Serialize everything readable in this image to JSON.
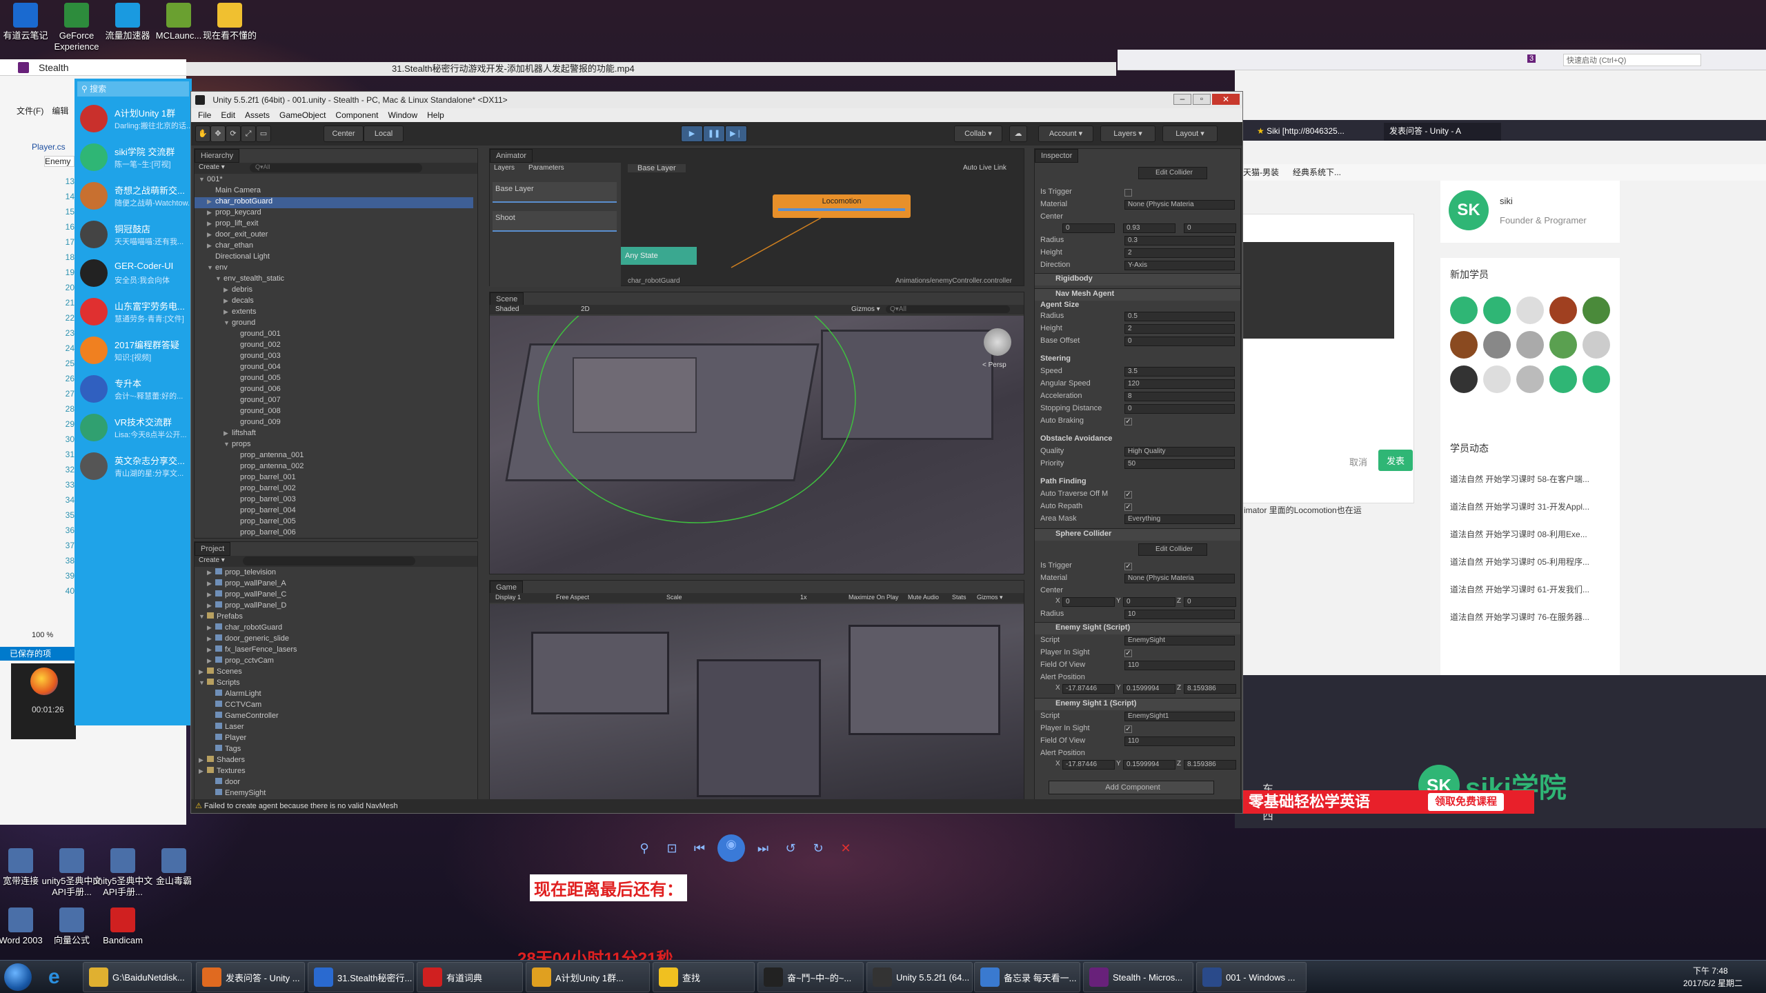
{
  "desktop": {
    "icons_top": [
      "有道云笔记",
      "GeForce Experience",
      "流量加速器",
      "MCLaunc...",
      "现在看不懂的"
    ],
    "icons_bottom": [
      "宽带连接",
      "unity5圣典中文API手册...",
      "unity5圣典中文API手册...",
      "金山毒霸",
      "Word 2003",
      "向量公式",
      "Bandicam"
    ],
    "countdown_label": "现在距离最后还有：",
    "countdown_value": "28天04小时11分21秒"
  },
  "video_player": {
    "title": "31.Stealth秘密行动游戏开发-添加机器人发起警报的功能.mp4",
    "time": "00:01:26"
  },
  "vs": {
    "title": "Stealth",
    "menu": [
      "文件(F)",
      "编辑"
    ],
    "tab": "Player.cs",
    "dropdown": "Enemy",
    "line_numbers": [
      "13",
      "14",
      "15",
      "16",
      "17",
      "18",
      "19",
      "20",
      "21",
      "22",
      "23",
      "24",
      "25",
      "26",
      "27",
      "28",
      "29",
      "30",
      "31",
      "32",
      "33",
      "34",
      "35",
      "36",
      "37",
      "38",
      "39",
      "40"
    ],
    "zoom": "100 %",
    "status": "已保存的项",
    "quick_launch": "快速启动 (Ctrl+Q)",
    "badge": "3"
  },
  "qq": {
    "search": "搜索",
    "items": [
      {
        "name": "A计划Unity 1群",
        "msg": "Darling:搬往北京的话...",
        "color": "#c9302c"
      },
      {
        "name": "siki学院 交流群",
        "msg": "陈一笔~生:[可视]",
        "color": "#2fb675"
      },
      {
        "name": "奇想之战萌新交...",
        "msg": "随便之战萌-Watchtow...",
        "color": "#c87030"
      },
      {
        "name": "铜冠鼓店",
        "msg": "天天喵喵喵:还有我...",
        "color": "#444"
      },
      {
        "name": "GER-Coder-UI",
        "msg": "安全员:我会向体",
        "color": "#222"
      },
      {
        "name": "山东富宇劳务电...",
        "msg": "慧通劳务-青青:[文件]",
        "color": "#e03030"
      },
      {
        "name": "2017编程群答疑",
        "msg": "知识:[视频]",
        "color": "#f08020"
      },
      {
        "name": "专升本",
        "msg": "会计~-释慧蕾:好的...",
        "color": "#3060c0"
      },
      {
        "name": "VR技术交流群",
        "msg": "Lisa:今天8点半公开...",
        "color": "#30a070"
      },
      {
        "name": "英文杂志分享交...",
        "msg": "青山湖的星:分享文...",
        "color": "#555"
      }
    ]
  },
  "browser": {
    "tabs": [
      "Siki [http://8046325...",
      "发表问答 - Unity - A"
    ],
    "bookmarks": [
      "天猫-男装",
      "经典系统下..."
    ],
    "profile": {
      "name": "siki",
      "role": "Founder & Programer"
    },
    "new_students_title": "新加学员",
    "activity_title": "学员动态",
    "activities": [
      "道法自然 开始学习课时 58-在客户端...",
      "道法自然 开始学习课时 31-开发Appl...",
      "道法自然 开始学习课时 08-利用Exe...",
      "道法自然 开始学习课时 05-利用程序...",
      "道法自然 开始学习课时 61-开发我们...",
      "道法自然 开始学习课时 76-在服务器..."
    ],
    "cancel": "取消",
    "submit": "发表",
    "text_snippet": "imator 里面的Locomotion也在运",
    "logo": "siki学院",
    "side_chars": [
      "东",
      "西"
    ],
    "banner": "零基础轻松学英语",
    "banner_btn": "领取免费课程"
  },
  "unity": {
    "title": "Unity 5.5.2f1 (64bit) - 001.unity - Stealth - PC, Mac & Linux Standalone* <DX11>",
    "menu": [
      "File",
      "Edit",
      "Assets",
      "GameObject",
      "Component",
      "Window",
      "Help"
    ],
    "toolbar": {
      "center": "Center",
      "local": "Local",
      "collab": "Collab ▾",
      "account": "Account ▾",
      "layers": "Layers ▾",
      "layout": "Layout ▾"
    },
    "hierarchy": {
      "tab": "Hierarchy",
      "create": "Create ▾",
      "search": "Q▾All",
      "rows": [
        {
          "t": "001*",
          "d": 0,
          "a": "▼"
        },
        {
          "t": "Main Camera",
          "d": 1,
          "a": ""
        },
        {
          "t": "char_robotGuard",
          "d": 1,
          "a": "▶",
          "sel": true
        },
        {
          "t": "prop_keycard",
          "d": 1,
          "a": "▶"
        },
        {
          "t": "prop_lift_exit",
          "d": 1,
          "a": "▶"
        },
        {
          "t": "door_exit_outer",
          "d": 1,
          "a": "▶"
        },
        {
          "t": "char_ethan",
          "d": 1,
          "a": "▶"
        },
        {
          "t": "Directional Light",
          "d": 1,
          "a": ""
        },
        {
          "t": "env",
          "d": 1,
          "a": "▼"
        },
        {
          "t": "env_stealth_static",
          "d": 2,
          "a": "▼"
        },
        {
          "t": "debris",
          "d": 3,
          "a": "▶"
        },
        {
          "t": "decals",
          "d": 3,
          "a": "▶"
        },
        {
          "t": "extents",
          "d": 3,
          "a": "▶"
        },
        {
          "t": "ground",
          "d": 3,
          "a": "▼"
        },
        {
          "t": "ground_001",
          "d": 4,
          "a": ""
        },
        {
          "t": "ground_002",
          "d": 4,
          "a": ""
        },
        {
          "t": "ground_003",
          "d": 4,
          "a": ""
        },
        {
          "t": "ground_004",
          "d": 4,
          "a": ""
        },
        {
          "t": "ground_005",
          "d": 4,
          "a": ""
        },
        {
          "t": "ground_006",
          "d": 4,
          "a": ""
        },
        {
          "t": "ground_007",
          "d": 4,
          "a": ""
        },
        {
          "t": "ground_008",
          "d": 4,
          "a": ""
        },
        {
          "t": "ground_009",
          "d": 4,
          "a": ""
        },
        {
          "t": "liftshaft",
          "d": 3,
          "a": "▶"
        },
        {
          "t": "props",
          "d": 3,
          "a": "▼"
        },
        {
          "t": "prop_antenna_001",
          "d": 4,
          "a": ""
        },
        {
          "t": "prop_antenna_002",
          "d": 4,
          "a": ""
        },
        {
          "t": "prop_barrel_001",
          "d": 4,
          "a": ""
        },
        {
          "t": "prop_barrel_002",
          "d": 4,
          "a": ""
        },
        {
          "t": "prop_barrel_003",
          "d": 4,
          "a": ""
        },
        {
          "t": "prop_barrel_004",
          "d": 4,
          "a": ""
        },
        {
          "t": "prop_barrel_005",
          "d": 4,
          "a": ""
        },
        {
          "t": "prop_barrel_006",
          "d": 4,
          "a": ""
        }
      ]
    },
    "project": {
      "tab": "Project",
      "create": "Create ▾",
      "rows": [
        {
          "t": "prop_television",
          "d": 1,
          "a": "▶"
        },
        {
          "t": "prop_wallPanel_A",
          "d": 1,
          "a": "▶"
        },
        {
          "t": "prop_wallPanel_C",
          "d": 1,
          "a": "▶"
        },
        {
          "t": "prop_wallPanel_D",
          "d": 1,
          "a": "▶"
        },
        {
          "t": "Prefabs",
          "d": 0,
          "a": "▼"
        },
        {
          "t": "char_robotGuard",
          "d": 1,
          "a": "▶"
        },
        {
          "t": "door_generic_slide",
          "d": 1,
          "a": "▶"
        },
        {
          "t": "fx_laserFence_lasers",
          "d": 1,
          "a": "▶"
        },
        {
          "t": "prop_cctvCam",
          "d": 1,
          "a": "▶"
        },
        {
          "t": "Scenes",
          "d": 0,
          "a": "▶"
        },
        {
          "t": "Scripts",
          "d": 0,
          "a": "▼"
        },
        {
          "t": "AlarmLight",
          "d": 1,
          "a": ""
        },
        {
          "t": "CCTVCam",
          "d": 1,
          "a": ""
        },
        {
          "t": "GameController",
          "d": 1,
          "a": ""
        },
        {
          "t": "Laser",
          "d": 1,
          "a": ""
        },
        {
          "t": "Player",
          "d": 1,
          "a": ""
        },
        {
          "t": "Tags",
          "d": 1,
          "a": ""
        },
        {
          "t": "Shaders",
          "d": 0,
          "a": "▶"
        },
        {
          "t": "Textures",
          "d": 0,
          "a": "▶"
        },
        {
          "t": "door",
          "d": 1,
          "a": ""
        },
        {
          "t": "EnemySight",
          "d": 1,
          "a": ""
        }
      ]
    },
    "animator": {
      "tab": "Animator",
      "layers": "Layers",
      "parameters": "Parameters",
      "base_layer": "Base Layer",
      "auto_live": "Auto Live Link",
      "layer_items": [
        "Base Layer",
        "Shoot"
      ],
      "state": "Locomotion",
      "any_state": "Any State",
      "footer_left": "char_robotGuard",
      "footer_right": "Animations/enemyController.controller"
    },
    "scene": {
      "tab": "Scene",
      "shaded": "Shaded",
      "mode2d": "2D",
      "gizmos": "Gizmos ▾",
      "search": "Q▾All",
      "persp": "< Persp"
    },
    "game": {
      "tab": "Game",
      "display": "Display 1",
      "aspect": "Free Aspect",
      "scale": "Scale",
      "scale_val": "1x",
      "maximize": "Maximize On Play",
      "mute": "Mute Audio",
      "stats": "Stats",
      "gizmos": "Gizmos ▾"
    },
    "inspector": {
      "tab": "Inspector",
      "edit_collider": "Edit Collider",
      "capsule": {
        "is_trigger": "Is Trigger",
        "material": "Material",
        "material_val": "None (Physic Materia",
        "center": "Center",
        "cx": "0",
        "cy": "0.93",
        "cz": "0",
        "radius": "Radius",
        "radius_val": "0.3",
        "height": "Height",
        "height_val": "2",
        "direction": "Direction",
        "direction_val": "Y-Axis"
      },
      "rigidbody": "Rigidbody",
      "navmesh": {
        "title": "Nav Mesh Agent",
        "agent_size": "Agent Size",
        "radius": "0.5",
        "height": "2",
        "base_offset": "0",
        "steering": "Steering",
        "speed": "3.5",
        "angular": "120",
        "accel": "8",
        "stopping": "0",
        "auto_braking": "Auto Braking",
        "obstacle": "Obstacle Avoidance",
        "quality": "High Quality",
        "priority": "50",
        "path": "Path Finding",
        "traverse": "Auto Traverse Off M",
        "repath": "Auto Repath",
        "area": "Area Mask",
        "area_val": "Everything"
      },
      "sphere": {
        "title": "Sphere Collider",
        "cx": "0",
        "cy": "0",
        "cz": "0",
        "radius": "10"
      },
      "sight": {
        "title": "Enemy Sight (Script)",
        "script": "Script",
        "script_val": "EnemySight",
        "player_in": "Player In Sight",
        "fov": "Field Of View",
        "fov_val": "110",
        "alert": "Alert Position",
        "ax": "-17.87446",
        "ay": "0.1599994",
        "az": "8.159386"
      },
      "sight1": {
        "title": "Enemy Sight 1 (Script)",
        "script_val": "EnemySight1",
        "fov_val": "110",
        "ax": "-17.87446",
        "ay": "0.1599994",
        "az": "8.159386"
      },
      "add": "Add Component",
      "labels": {
        "radius": "Radius",
        "height": "Height",
        "base_offset": "Base Offset",
        "speed": "Speed",
        "angular": "Angular Speed",
        "accel": "Acceleration",
        "stopping": "Stopping Distance",
        "quality": "Quality",
        "priority": "Priority",
        "center": "Center",
        "is_trigger": "Is Trigger",
        "material": "Material",
        "script": "Script"
      }
    },
    "status": "Failed to create agent because there is no valid NavMesh"
  },
  "photo_viewer": {
    "buttons": [
      "search-icon",
      "fit-icon",
      "prev-icon",
      "slideshow-icon",
      "next-icon",
      "rotate-left-icon",
      "rotate-right-icon",
      "delete-icon"
    ]
  },
  "taskbar": {
    "items": [
      "G:\\BaiduNetdisk...",
      "发表问答 - Unity ...",
      "31.Stealth秘密行...",
      "有道词典",
      "A计划Unity 1群...",
      "查找",
      "奋~鬥~中~的~...",
      "Unity 5.5.2f1 (64...",
      "备忘录 每天看一...",
      "Stealth - Micros...",
      "001 - Windows ..."
    ],
    "time": "下午 7:48",
    "date": "2017/5/2 星期二"
  },
  "colors": {
    "unity_bg": "#383838",
    "unity_panel": "#3c3c3c",
    "qq_blue": "#1fa3e8",
    "accent_green": "#2fb675"
  }
}
